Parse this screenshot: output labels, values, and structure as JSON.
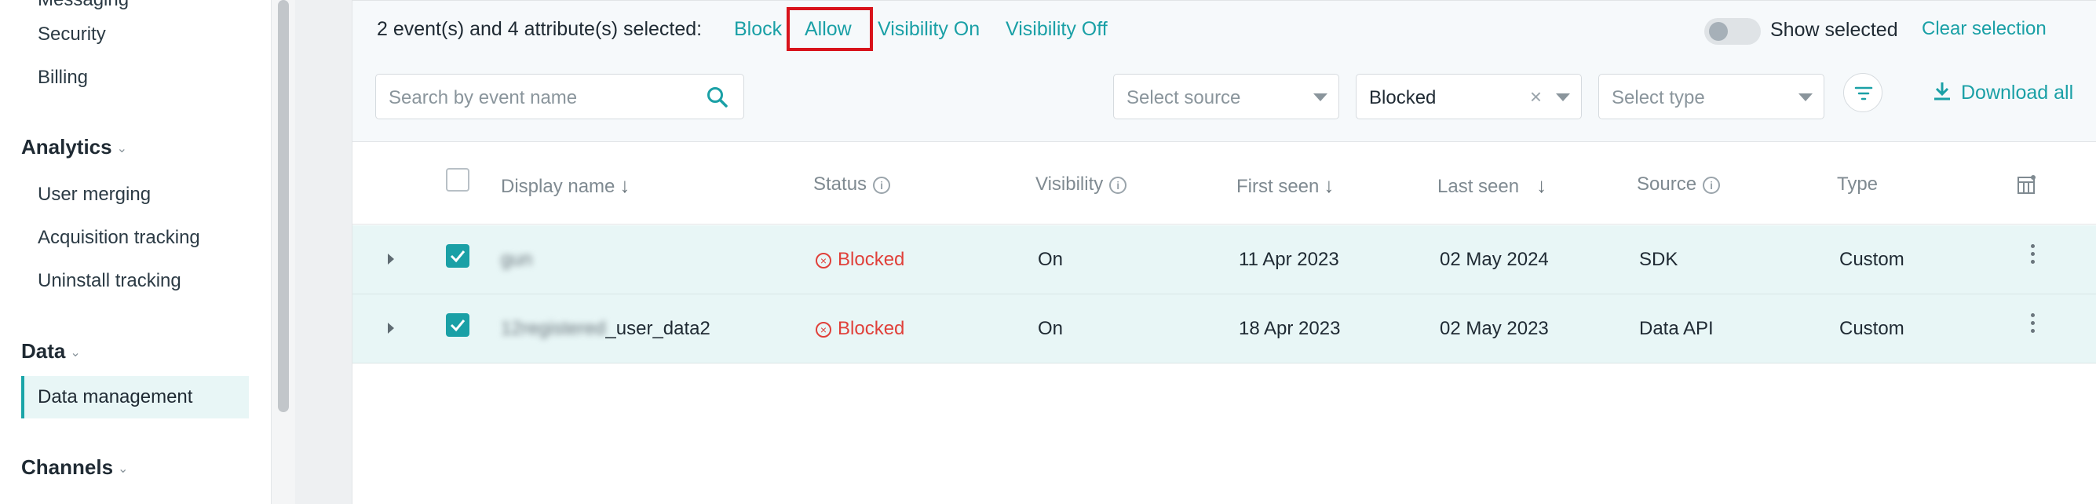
{
  "sidebar": {
    "partial_top_item": "Messaging",
    "items_top": [
      "Security",
      "Billing"
    ],
    "analytics": {
      "label": "Analytics",
      "items": [
        "User merging",
        "Acquisition tracking",
        "Uninstall tracking"
      ]
    },
    "data": {
      "label": "Data",
      "items": [
        "Data management"
      ]
    },
    "channels": {
      "label": "Channels"
    }
  },
  "toolbar": {
    "selection_text": "2 event(s) and 4 attribute(s) selected:",
    "actions": [
      "Block",
      "Allow",
      "Visibility On",
      "Visibility Off"
    ],
    "show_selected_label": "Show selected",
    "clear_selection_label": "Clear selection"
  },
  "filters": {
    "search_placeholder": "Search by event name",
    "source_placeholder": "Select source",
    "status_value": "Blocked",
    "type_placeholder": "Select type",
    "download_label": "Download all"
  },
  "table": {
    "columns": [
      "Display name",
      "Status",
      "Visibility",
      "First seen",
      "Last seen",
      "Source",
      "Type"
    ],
    "rows": [
      {
        "name_blurred": "gun",
        "name_visible": "",
        "status": "Blocked",
        "visibility": "On",
        "first_seen": "11 Apr 2023",
        "last_seen": "02 May 2024",
        "source": "SDK",
        "type": "Custom"
      },
      {
        "name_blurred": "12registered",
        "name_visible": "_user_data2",
        "status": "Blocked",
        "visibility": "On",
        "first_seen": "18 Apr 2023",
        "last_seen": "02 May 2023",
        "source": "Data API",
        "type": "Custom"
      }
    ]
  },
  "colors": {
    "accent": "#1aa0a6",
    "blocked": "#e0403a",
    "highlight_box": "#d8131b",
    "selected_row": "#e8f6f6"
  }
}
